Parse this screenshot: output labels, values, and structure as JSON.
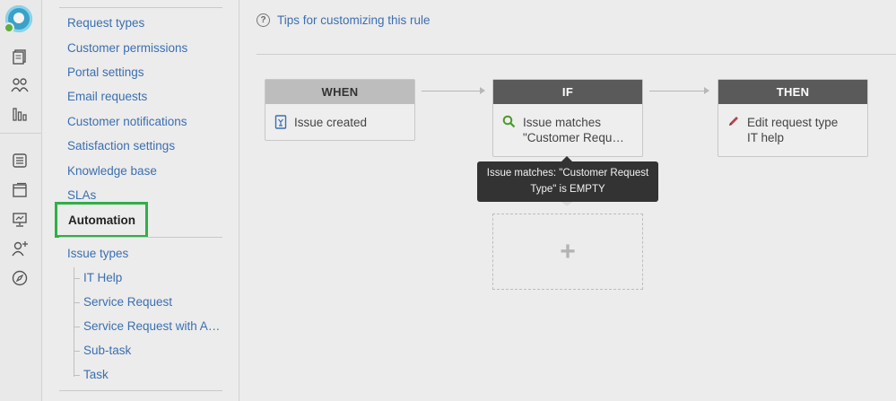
{
  "sidebar": {
    "items": [
      "Request types",
      "Customer permissions",
      "Portal settings",
      "Email requests",
      "Customer notifications",
      "Satisfaction settings",
      "Knowledge base",
      "SLAs"
    ],
    "active_item": "Automation",
    "issue_types_label": "Issue types",
    "issue_types": [
      "IT Help",
      "Service Request",
      "Service Request with A…",
      "Sub-task",
      "Task"
    ]
  },
  "rail_icons": [
    "app-logo-icon",
    "document-icon",
    "people-icon",
    "bar-chart-icon",
    "queue-icon",
    "knowledge-icon",
    "monitor-icon",
    "add-person-icon",
    "compass-icon"
  ],
  "main": {
    "tips_label": "Tips for customizing this rule",
    "when": {
      "title": "WHEN",
      "item": "Issue created"
    },
    "if": {
      "title": "IF",
      "item_line1": "Issue matches",
      "item_line2": "\"Customer Requ…"
    },
    "then": {
      "title": "THEN",
      "item_line1": "Edit request type",
      "item_line2": "IT help"
    },
    "tooltip": {
      "line1": "Issue matches: \"Customer Request",
      "line2": "Type\" is EMPTY"
    },
    "add_label": "+"
  },
  "colors": {
    "link": "#3b6fb1",
    "active_outline": "#2fb044",
    "when_header": "#bdbdbd",
    "if_header": "#5a5a5a",
    "then_header": "#5a5a5a"
  }
}
